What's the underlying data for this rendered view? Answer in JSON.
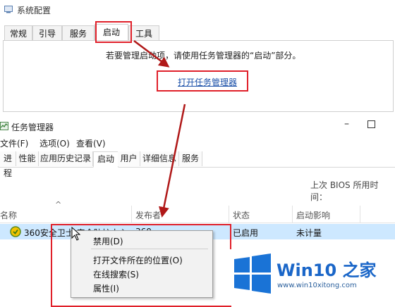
{
  "system_config": {
    "title": "系统配置",
    "tabs": [
      "常规",
      "引导",
      "服务",
      "启动",
      "工具"
    ],
    "active_tab": "启动",
    "hint": "若要管理启动项，请使用任务管理器的“启动”部分。",
    "open_link": "打开任务管理器"
  },
  "task_manager": {
    "title": "任务管理器",
    "menu": [
      "文件(F)",
      "选项(O)",
      "查看(V)"
    ],
    "tabs": [
      "进程",
      "性能",
      "应用历史记录",
      "启动",
      "用户",
      "详细信息",
      "服务"
    ],
    "active_tab": "启动",
    "bios_label": "上次 BIOS 所用时间：",
    "columns": [
      "名称",
      "发布者",
      "状态",
      "启动影响"
    ],
    "rows": [
      {
        "name": "360安全卫士 安全防护中心",
        "publisher": "360",
        "status": "已启用",
        "impact": "未计量"
      }
    ]
  },
  "context_menu": {
    "items": [
      "禁用(D)",
      "打开文件所在的位置(O)",
      "在线搜索(S)",
      "属性(I)"
    ]
  },
  "watermark": {
    "brand": "Win10 之家",
    "url": "www.win10xitong.com"
  },
  "colors": {
    "highlight_red": "#e0202a",
    "arrow_red": "#b01818",
    "selection": "#cde8ff",
    "brand_blue": "#1a66c8"
  }
}
